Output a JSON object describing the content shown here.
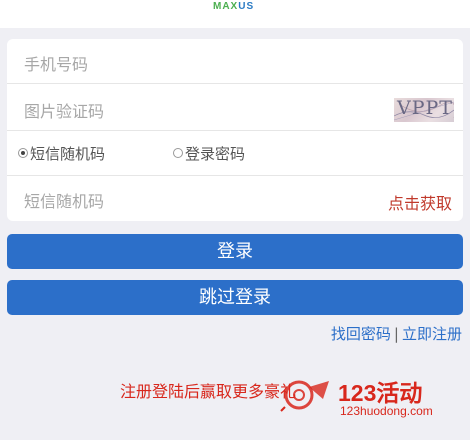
{
  "header": {
    "logo_text": "MAXUS"
  },
  "form": {
    "phone_placeholder": "手机号码",
    "captcha_placeholder": "图片验证码",
    "captcha_text": "VPPT",
    "mode_options": [
      {
        "label": "短信随机码",
        "selected": true
      },
      {
        "label": "登录密码",
        "selected": false
      }
    ],
    "sms_code_placeholder": "短信随机码",
    "get_code_link": "点击获取"
  },
  "buttons": {
    "login": "登录",
    "skip_login": "跳过登录"
  },
  "links": {
    "forgot_password": "找回密码",
    "separator": "|",
    "register": "立即注册"
  },
  "promo": {
    "text": "注册登陆后赢取更多豪礼"
  },
  "watermark": {
    "title": "123活动",
    "url": "123huodong.com"
  },
  "colors": {
    "primary_blue": "#2c6fc9",
    "link_red": "#c0392b",
    "background": "#efeff4",
    "logo_green": "#4caf50",
    "logo_blue": "#2b7bc4"
  }
}
